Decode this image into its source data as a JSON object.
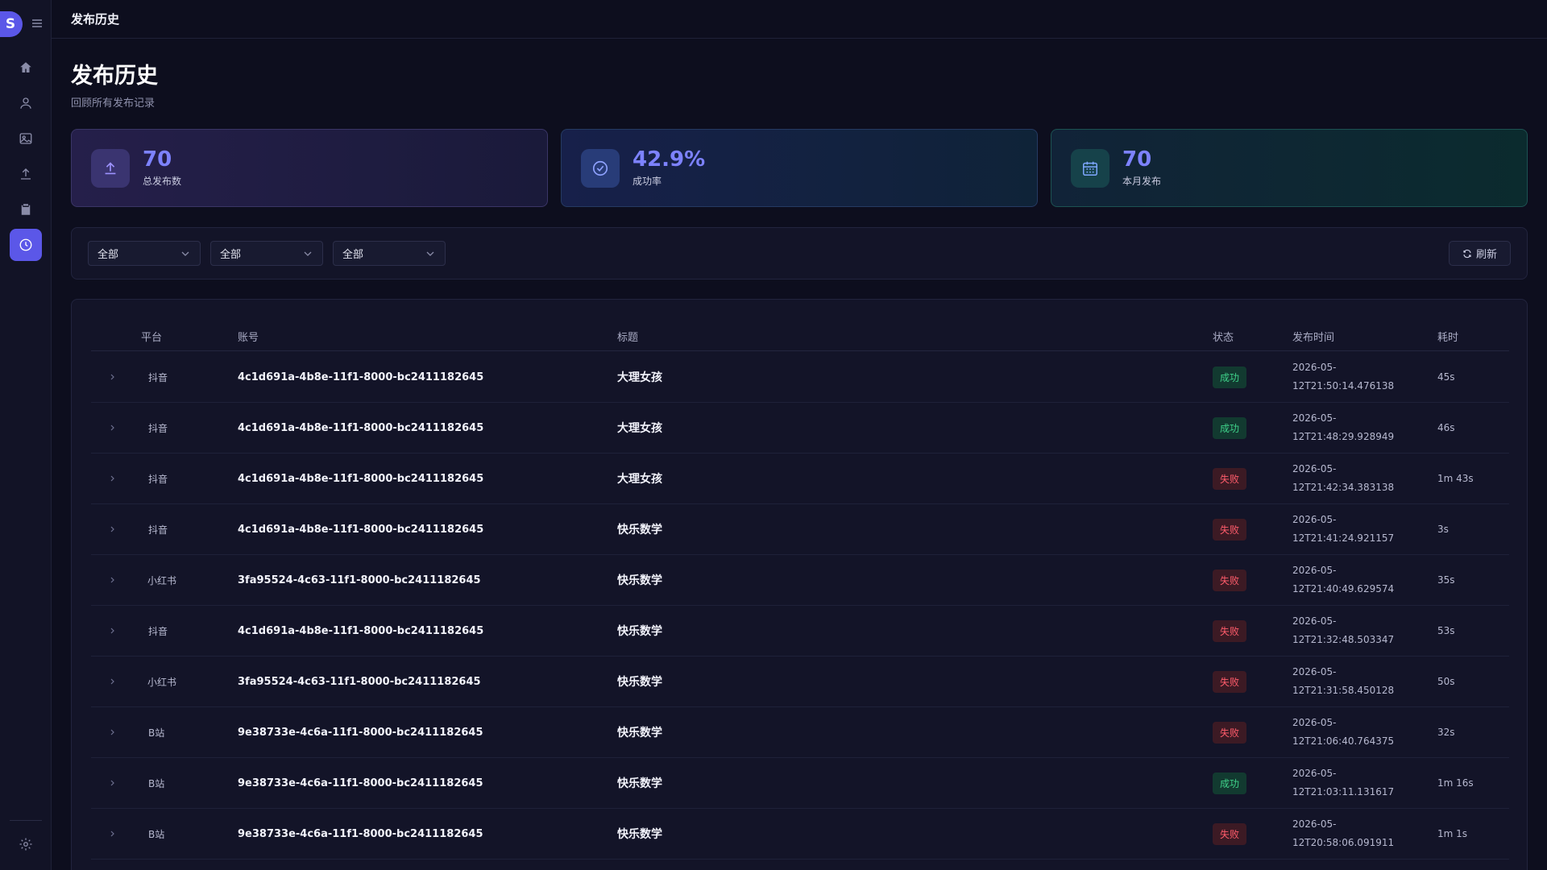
{
  "brand": {
    "letter": "S"
  },
  "topbar": {
    "title": "发布历史"
  },
  "page": {
    "title": "发布历史",
    "subtitle": "回顾所有发布记录"
  },
  "stats": [
    {
      "value": "70",
      "label": "总发布数",
      "icon": "upload-icon"
    },
    {
      "value": "42.9%",
      "label": "成功率",
      "icon": "check-circle-icon"
    },
    {
      "value": "70",
      "label": "本月发布",
      "icon": "calendar-icon"
    }
  ],
  "nav": [
    {
      "icon": "home-icon",
      "active": false
    },
    {
      "icon": "user-icon",
      "active": false
    },
    {
      "icon": "image-icon",
      "active": false
    },
    {
      "icon": "upload-icon",
      "active": false
    },
    {
      "icon": "clipboard-icon",
      "active": false
    },
    {
      "icon": "clock-icon",
      "active": true
    },
    {
      "icon": "gear-icon",
      "active": false
    }
  ],
  "filters": [
    {
      "value": "全部"
    },
    {
      "value": "全部"
    },
    {
      "value": "全部"
    }
  ],
  "refresh_label": "刷新",
  "table": {
    "columns": [
      "平台",
      "账号",
      "标题",
      "状态",
      "发布时间",
      "耗时"
    ],
    "rows": [
      {
        "platform": "抖音",
        "account": "4c1d691a-4b8e-11f1-8000-bc2411182645",
        "title": "大理女孩",
        "status": "成功",
        "ok": true,
        "time1": "2026-05-",
        "time2": "12T21:50:14.476138",
        "duration": "45s"
      },
      {
        "platform": "抖音",
        "account": "4c1d691a-4b8e-11f1-8000-bc2411182645",
        "title": "大理女孩",
        "status": "成功",
        "ok": true,
        "time1": "2026-05-",
        "time2": "12T21:48:29.928949",
        "duration": "46s"
      },
      {
        "platform": "抖音",
        "account": "4c1d691a-4b8e-11f1-8000-bc2411182645",
        "title": "大理女孩",
        "status": "失败",
        "ok": false,
        "time1": "2026-05-",
        "time2": "12T21:42:34.383138",
        "duration": "1m 43s"
      },
      {
        "platform": "抖音",
        "account": "4c1d691a-4b8e-11f1-8000-bc2411182645",
        "title": "快乐数学",
        "status": "失败",
        "ok": false,
        "time1": "2026-05-",
        "time2": "12T21:41:24.921157",
        "duration": "3s"
      },
      {
        "platform": "小红书",
        "account": "3fa95524-4c63-11f1-8000-bc2411182645",
        "title": "快乐数学",
        "status": "失败",
        "ok": false,
        "time1": "2026-05-",
        "time2": "12T21:40:49.629574",
        "duration": "35s"
      },
      {
        "platform": "抖音",
        "account": "4c1d691a-4b8e-11f1-8000-bc2411182645",
        "title": "快乐数学",
        "status": "失败",
        "ok": false,
        "time1": "2026-05-",
        "time2": "12T21:32:48.503347",
        "duration": "53s"
      },
      {
        "platform": "小红书",
        "account": "3fa95524-4c63-11f1-8000-bc2411182645",
        "title": "快乐数学",
        "status": "失败",
        "ok": false,
        "time1": "2026-05-",
        "time2": "12T21:31:58.450128",
        "duration": "50s"
      },
      {
        "platform": "B站",
        "account": "9e38733e-4c6a-11f1-8000-bc2411182645",
        "title": "快乐数学",
        "status": "失败",
        "ok": false,
        "time1": "2026-05-",
        "time2": "12T21:06:40.764375",
        "duration": "32s"
      },
      {
        "platform": "B站",
        "account": "9e38733e-4c6a-11f1-8000-bc2411182645",
        "title": "快乐数学",
        "status": "成功",
        "ok": true,
        "time1": "2026-05-",
        "time2": "12T21:03:11.131617",
        "duration": "1m 16s"
      },
      {
        "platform": "B站",
        "account": "9e38733e-4c6a-11f1-8000-bc2411182645",
        "title": "快乐数学",
        "status": "失败",
        "ok": false,
        "time1": "2026-05-",
        "time2": "12T20:58:06.091911",
        "duration": "1m 1s"
      }
    ]
  },
  "colors": {
    "accent": "#5b57e8",
    "success": "#3fd28a",
    "failure": "#ff5c6b",
    "background": "#0d0e1e"
  }
}
